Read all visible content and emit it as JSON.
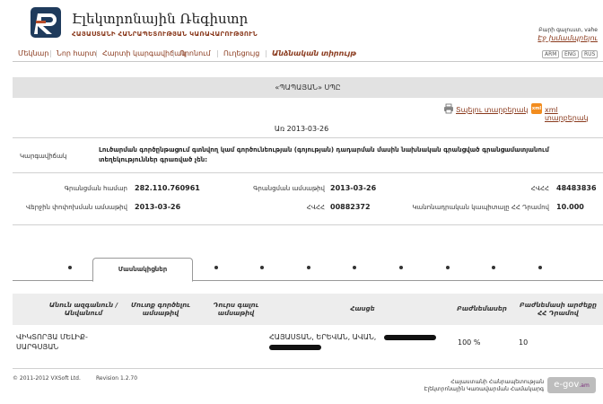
{
  "header": {
    "title": "Էլեկտրոնային Ռեգիստր",
    "subtitle": "ՀԱՅԱՍՏԱՆԻ ՀԱՆՐԱՊԵՏՈՒԹՅԱՆ ԿԱՌԱՎԱՐՈՒԹՅՈՒՆ",
    "welcome": "Բարի գալուստ, vahe",
    "login_link": "Էջ խմամպրելու"
  },
  "nav": {
    "items": [
      "Մեկնար",
      "Նոր հարտ",
      "Հարտի կարգավիճակ",
      "Որոնում",
      "Ուղեցույց",
      "Անձնական տիրույթ"
    ],
    "langs": [
      "ARM",
      "ENG",
      "RUS"
    ]
  },
  "page": {
    "title": "«ՊԱՊԱՅԱՆ» ՍՊԸ",
    "print_link": "Տպելու տարբերակ",
    "xml_link": "xml տարբերակ",
    "xml_badge": "xml",
    "date_line": "Առ 2013-03-26"
  },
  "status": {
    "label": "Կարգավիճակ",
    "text": "Լուծարման գործընթացում գտնվող կամ գործունեության (գոյության) դադարման մասին նախնական գրանցված գրանցամատյանում տեղեկություններ գրառված չեն:"
  },
  "fields": {
    "reg_number_label": "Գրանցման համար",
    "reg_number": "282.110.760961",
    "reg_date_label": "Գրանցման ամսաթիվ",
    "reg_date": "2013-03-26",
    "tax_id_label": "ՀՎՀՀ",
    "tax_id": "48483836",
    "change_date_label": "Վերջին փոփոխման ամսաթիվ",
    "change_date": "2013-03-26",
    "vat_label": "ՀՎՀՀ",
    "vat": "00882372",
    "capital_label": "Կանոնադրական կապիտալը ՀՀ Դրամով",
    "capital": "10.000"
  },
  "tabs": {
    "active": "Մասնակիցներ"
  },
  "table": {
    "headers": [
      "Անուն ազգանուն / Անվանում",
      "Մուտք գործելու ամսաթիվ",
      "Դուրս գալու ամսաթիվ",
      "Հասցե",
      "Բաժնեմասեր",
      "Բաժնեմասի արժեքը ՀՀ Դրամով"
    ],
    "row": {
      "name": "ՎԻԿՏՈՐՅԱ ՄԵԼԻՔ-ՍԱՐԳՍՅԱՆ",
      "address": "ՀԱՅԱՍՏԱՆ, ԵՐԵՎԱՆ, ԱՎԱՆ,",
      "share": "100 %",
      "value": "10"
    }
  },
  "footer": {
    "copyright": "© 2011-2012 VXSoft Ltd.",
    "revision": "Revision 1.2.70",
    "right_line1": "Հայաստանի Հանրապետության",
    "right_line2": "Էլեկտրոնային Կառավարման Համակարգ",
    "egov": "e-gov",
    "egov_suffix": ".am"
  },
  "colors": {
    "accent": "#8a3a1d",
    "logo": "#1f3b5c",
    "title_bar": "#e2e2e2"
  }
}
